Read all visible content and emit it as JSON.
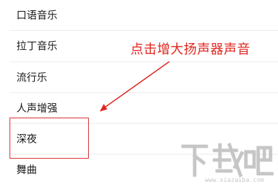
{
  "items": [
    {
      "label": "口语音乐"
    },
    {
      "label": "拉丁音乐"
    },
    {
      "label": "流行乐"
    },
    {
      "label": "人声增强"
    },
    {
      "label": "深夜"
    },
    {
      "label": "舞曲"
    }
  ],
  "annotation": {
    "text": "点击增大扬声器声音"
  },
  "watermark": {
    "logo_text": "下载吧",
    "url": "www.xiazaiba.com"
  },
  "colors": {
    "annotation_red": "#e0261f",
    "highlight_red": "#d5282a"
  }
}
